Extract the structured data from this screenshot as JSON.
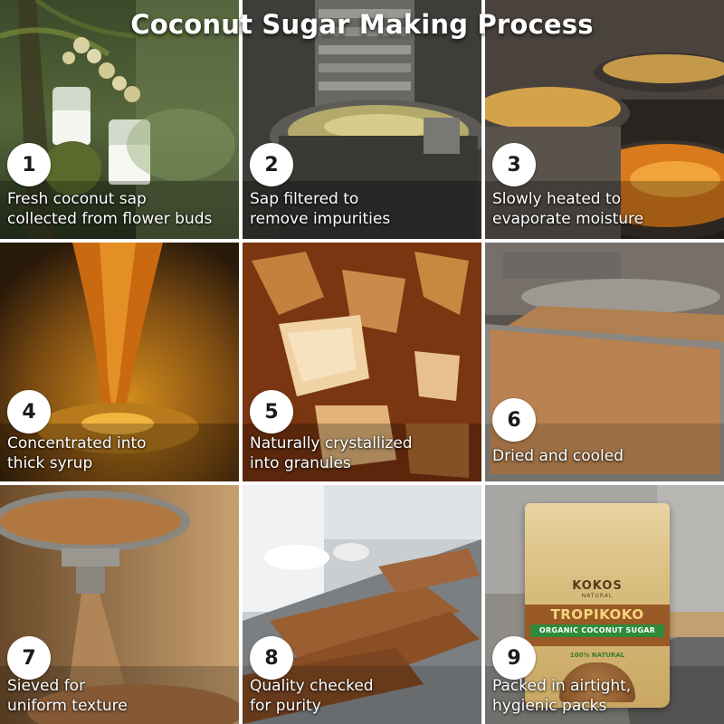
{
  "title": "Coconut Sugar Making Process",
  "steps": [
    {
      "number": "1",
      "lines": [
        "Fresh coconut sap",
        "collected from flower buds"
      ]
    },
    {
      "number": "2",
      "lines": [
        "Sap filtered to",
        "remove impurities"
      ]
    },
    {
      "number": "3",
      "lines": [
        "Slowly heated to",
        "evaporate moisture"
      ]
    },
    {
      "number": "4",
      "lines": [
        "Concentrated into",
        "thick syrup"
      ]
    },
    {
      "number": "5",
      "lines": [
        "Naturally crystallized",
        "into granules"
      ]
    },
    {
      "number": "6",
      "lines": [
        "Dried and cooled"
      ]
    },
    {
      "number": "7",
      "lines": [
        "Sieved for",
        "uniform texture"
      ]
    },
    {
      "number": "8",
      "lines": [
        "Quality checked",
        "for purity"
      ]
    },
    {
      "number": "9",
      "lines": [
        "Packed in airtight,",
        "hygienic packs"
      ]
    }
  ],
  "package": {
    "brand": "KOKOS",
    "brand_sub": "NATURAL",
    "product": "TROPIKOKO",
    "kind": "ORGANIC COCONUT SUGAR",
    "claim": "100% NATURAL"
  }
}
